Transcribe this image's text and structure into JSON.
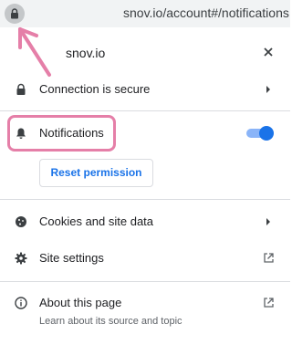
{
  "address_bar": {
    "url": "snov.io/account#/notifications",
    "lock_icon": "lock-icon"
  },
  "annotation": {
    "arrow_color": "#e57fa8",
    "highlight_color": "#e57fa8"
  },
  "popup": {
    "title": "snov.io",
    "close_icon": "close-icon",
    "connection": {
      "label": "Connection is secure",
      "icon": "lock-icon"
    },
    "notifications": {
      "label": "Notifications",
      "icon": "bell-icon",
      "toggle_on": true
    },
    "reset_permission_label": "Reset permission",
    "cookies": {
      "label": "Cookies and site data",
      "icon": "cookie-icon"
    },
    "site_settings": {
      "label": "Site settings",
      "icon": "gear-icon"
    },
    "about": {
      "label": "About this page",
      "sublabel": "Learn about its source and topic",
      "icon": "info-icon"
    }
  },
  "colors": {
    "accent": "#1a73e8",
    "toggle_track": "#8ab4f8",
    "divider": "#dadce0"
  }
}
